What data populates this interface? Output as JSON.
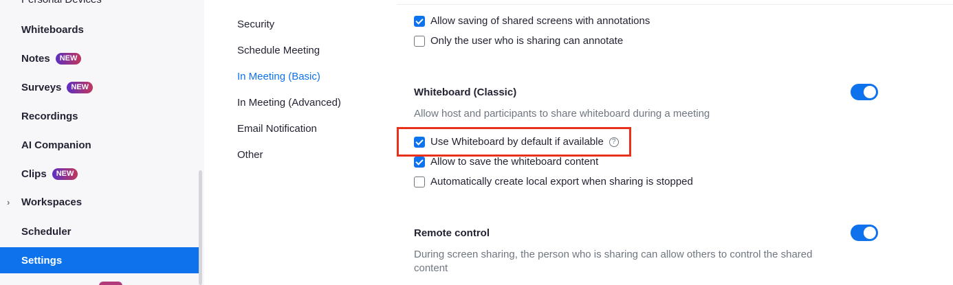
{
  "sidebar": {
    "cut_top_label": "Personal Devices",
    "items": [
      {
        "label": "Whiteboards",
        "badge": ""
      },
      {
        "label": "Notes",
        "badge": "NEW"
      },
      {
        "label": "Surveys",
        "badge": "NEW"
      },
      {
        "label": "Recordings",
        "badge": ""
      },
      {
        "label": "AI Companion",
        "badge": ""
      },
      {
        "label": "Clips",
        "badge": "NEW"
      },
      {
        "label": "Workspaces",
        "badge": ""
      },
      {
        "label": "Scheduler",
        "badge": ""
      },
      {
        "label": "Settings",
        "badge": ""
      }
    ],
    "workspaces_chevron": "›"
  },
  "subnav": {
    "items": [
      "Security",
      "Schedule Meeting",
      "In Meeting (Basic)",
      "In Meeting (Advanced)",
      "Email Notification",
      "Other"
    ],
    "active": "In Meeting (Basic)"
  },
  "annotation": {
    "options": [
      {
        "label": "Allow saving of shared screens with annotations",
        "checked": true
      },
      {
        "label": "Only the user who is sharing can annotate",
        "checked": false
      }
    ]
  },
  "whiteboard": {
    "title": "Whiteboard (Classic)",
    "enabled": true,
    "description": "Allow host and participants to share whiteboard during a meeting",
    "options": [
      {
        "label": "Use Whiteboard by default if available",
        "checked": true,
        "help_icon": "?"
      },
      {
        "label": "Allow to save the whiteboard content",
        "checked": true
      },
      {
        "label": "Automatically create local export when sharing is stopped",
        "checked": false
      }
    ]
  },
  "remote_control": {
    "title": "Remote control",
    "enabled": true,
    "description": "During screen sharing, the person who is sharing can allow others to control the shared content"
  },
  "colors": {
    "accent": "#0e72ed",
    "highlight": "#e8301b",
    "badge_start": "#5c2fc2",
    "badge_end": "#c1375b"
  }
}
